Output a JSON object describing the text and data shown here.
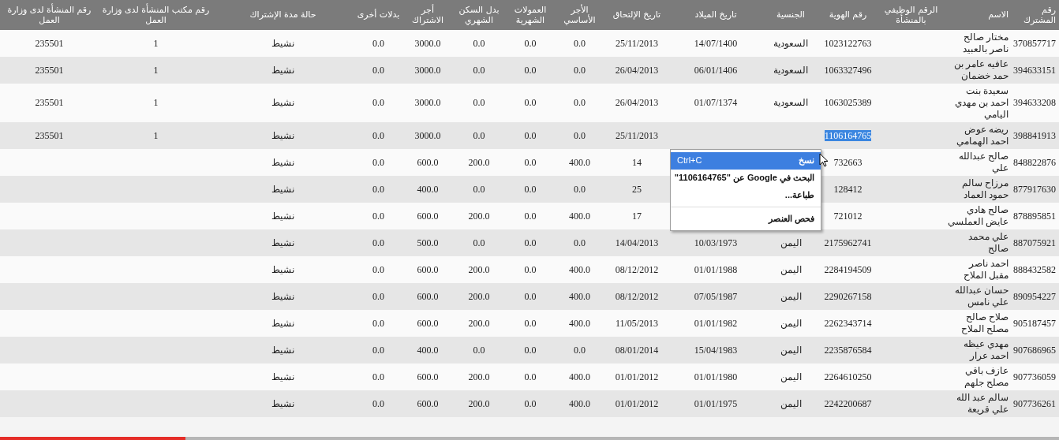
{
  "table": {
    "columns": [
      "رقم المشترك",
      "الاسم",
      "الرقم الوظيفي بالمنشأة",
      "رقم الهوية",
      "الجنسية",
      "تاريخ الميلاد",
      "تاريخ الإلتحاق",
      "الأجر الأساسي",
      "العمولات الشهرية",
      "بدل السكن الشهري",
      "أجر الاشتراك",
      "بدلات أخرى",
      "حالة مدة الإشتراك",
      "رقم مكتب المنشأة لدى وزارة العمل",
      "رقم المنشأة لدى وزارة العمل"
    ],
    "rows": [
      {
        "id_selected": false,
        "cells": [
          "370857717",
          "مختار صالح ناصر بالعبيد",
          null,
          "1023122763",
          "السعودية",
          "14/07/1400",
          "25/11/2013",
          "0.0",
          "0.0",
          "0.0",
          "3000.0",
          "0.0",
          "نشيط",
          "1",
          "235501"
        ]
      },
      {
        "id_selected": false,
        "cells": [
          "394633151",
          "عافيه عامر بن حمد خضمان",
          null,
          "1063327496",
          "السعودية",
          "06/01/1406",
          "26/04/2013",
          "0.0",
          "0.0",
          "0.0",
          "3000.0",
          "0.0",
          "نشيط",
          "1",
          "235501"
        ]
      },
      {
        "id_selected": false,
        "cells": [
          "394633208",
          "سعيدة بنت احمد بن مهدي اليامي",
          null,
          "1063025389",
          "السعودية",
          "01/07/1374",
          "26/04/2013",
          "0.0",
          "0.0",
          "0.0",
          "3000.0",
          "0.0",
          "نشيط",
          "1",
          "235501"
        ]
      },
      {
        "id_selected": true,
        "cells": [
          "398841913",
          "ريضه عوض احمد الهمامي",
          null,
          "1106164765",
          null,
          null,
          "25/11/2013",
          "0.0",
          "0.0",
          "0.0",
          "3000.0",
          "0.0",
          "نشيط",
          "1",
          "235501"
        ]
      },
      {
        "id_selected": false,
        "cells": [
          "848822876",
          "صالح عبدالله علي",
          null,
          "732663",
          null,
          null,
          "14",
          "400.0",
          "0.0",
          "200.0",
          "600.0",
          "0.0",
          "نشيط",
          null,
          null
        ]
      },
      {
        "id_selected": false,
        "cells": [
          "877917630",
          "مرزاح سالم حمود العماد",
          null,
          "128412",
          null,
          null,
          "25",
          "0.0",
          "0.0",
          "0.0",
          "400.0",
          "0.0",
          "نشيط",
          null,
          null
        ]
      },
      {
        "id_selected": false,
        "cells": [
          "878895851",
          "صالح هادي عايض العملسي",
          null,
          "721012",
          null,
          null,
          "17",
          "400.0",
          "0.0",
          "200.0",
          "600.0",
          "0.0",
          "نشيط",
          null,
          null
        ]
      },
      {
        "id_selected": false,
        "cells": [
          "887075921",
          "علي محمد صالح",
          null,
          "2175962741",
          "اليمن",
          "10/03/1973",
          "14/04/2013",
          "0.0",
          "0.0",
          "0.0",
          "500.0",
          "0.0",
          "نشيط",
          null,
          null
        ]
      },
      {
        "id_selected": false,
        "cells": [
          "888432582",
          "احمد ناصر مقبل الملاح",
          null,
          "2284194509",
          "اليمن",
          "01/01/1988",
          "08/12/2012",
          "400.0",
          "0.0",
          "200.0",
          "600.0",
          "0.0",
          "نشيط",
          null,
          null
        ]
      },
      {
        "id_selected": false,
        "cells": [
          "890954227",
          "حسان عبدالله علي نامس",
          null,
          "2290267158",
          "اليمن",
          "07/05/1987",
          "08/12/2012",
          "400.0",
          "0.0",
          "200.0",
          "600.0",
          "0.0",
          "نشيط",
          null,
          null
        ]
      },
      {
        "id_selected": false,
        "cells": [
          "905187457",
          "صلاح صالح مصلح الملاح",
          null,
          "2262343714",
          "اليمن",
          "01/01/1982",
          "11/05/2013",
          "400.0",
          "0.0",
          "200.0",
          "600.0",
          "0.0",
          "نشيط",
          null,
          null
        ]
      },
      {
        "id_selected": false,
        "cells": [
          "907686965",
          "مهدي عيظه احمد عرار",
          null,
          "2235876584",
          "اليمن",
          "15/04/1983",
          "08/01/2014",
          "0.0",
          "0.0",
          "0.0",
          "400.0",
          "0.0",
          "نشيط",
          null,
          null
        ]
      },
      {
        "id_selected": false,
        "cells": [
          "907736059",
          "عازف باقي مصلح جلهم",
          null,
          "2264610250",
          "اليمن",
          "01/01/1980",
          "01/01/2012",
          "400.0",
          "0.0",
          "200.0",
          "600.0",
          "0.0",
          "نشيط",
          null,
          null
        ]
      },
      {
        "id_selected": false,
        "cells": [
          "907736261",
          "سالم عبد الله علي قريعة",
          null,
          "2242200687",
          "اليمن",
          "01/01/1975",
          "01/01/2012",
          "400.0",
          "0.0",
          "200.0",
          "600.0",
          "0.0",
          "نشيط",
          null,
          null
        ]
      }
    ]
  },
  "context_menu": {
    "items": [
      {
        "kind": "item",
        "label": "نسخ",
        "shortcut": "Ctrl+C",
        "selected": true
      },
      {
        "kind": "item",
        "label": "البحث في Google عن \"1106164765\"",
        "selected": false
      },
      {
        "kind": "item",
        "label": "طباعة...",
        "selected": false
      },
      {
        "kind": "separator"
      },
      {
        "kind": "item",
        "label": "فحص العنصر",
        "selected": false
      }
    ]
  },
  "video_progress": {
    "level": 0.175
  }
}
